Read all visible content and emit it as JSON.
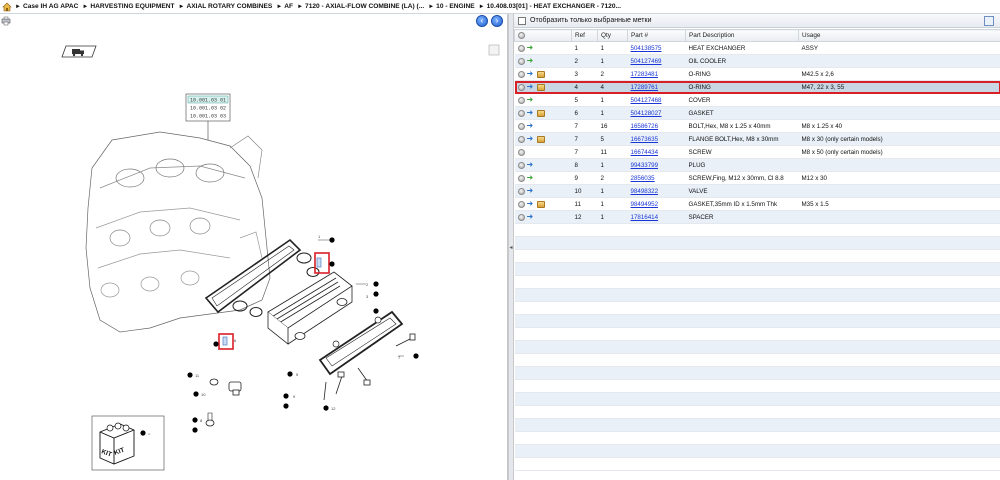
{
  "breadcrumbs": [
    "Case IH AG APAC",
    "HARVESTING EQUIPMENT",
    "AXIAL ROTARY COMBINES",
    "AF",
    "7120 - AXIAL-FLOW COMBINE (LA) (...",
    "10 - ENGINE",
    "10.408.03[01] - HEAT EXCHANGER - 7120..."
  ],
  "right_panel": {
    "filter_label": "Отобразить только выбранные метки",
    "columns": {
      "ref": "Ref",
      "qty": "Qty",
      "part": "Part #",
      "desc": "Part Description",
      "usage": "Usage"
    },
    "rows": [
      {
        "icons": [
          "dot",
          "arrow-green"
        ],
        "ref": "1",
        "qty": "1",
        "part": "504138575",
        "desc": "HEAT EXCHANGER",
        "usage": "ASSY"
      },
      {
        "icons": [
          "dot",
          "arrow-green"
        ],
        "ref": "2",
        "qty": "1",
        "part": "504127469",
        "desc": "OIL COOLER",
        "usage": ""
      },
      {
        "icons": [
          "dot",
          "arrow-blue",
          "box"
        ],
        "ref": "3",
        "qty": "2",
        "part": "17283481",
        "desc": "O-RING",
        "usage": "M42.5 x 2,6"
      },
      {
        "icons": [
          "dot",
          "arrow-blue",
          "box"
        ],
        "ref": "4",
        "qty": "4",
        "part": "17289761",
        "desc": "O-RING",
        "usage": "M47, 22 x 3, 55",
        "selected": true
      },
      {
        "icons": [
          "dot",
          "arrow-green"
        ],
        "ref": "5",
        "qty": "1",
        "part": "504127468",
        "desc": "COVER",
        "usage": ""
      },
      {
        "icons": [
          "dot",
          "arrow-blue",
          "box"
        ],
        "ref": "6",
        "qty": "1",
        "part": "504128027",
        "desc": "GASKET",
        "usage": ""
      },
      {
        "icons": [
          "dot",
          "arrow-blue"
        ],
        "ref": "7",
        "qty": "16",
        "part": "16586726",
        "desc": "BOLT,Hex, M8 x 1.25 x 40mm",
        "usage": "M8 x 1.25 x 40"
      },
      {
        "icons": [
          "dot",
          "arrow-blue",
          "box"
        ],
        "ref": "7",
        "qty": "5",
        "part": "16673635",
        "desc": "FLANGE BOLT,Hex, M8 x 30mm",
        "usage": "M8 x 30 (only certain models)"
      },
      {
        "icons": [
          "dot"
        ],
        "ref": "7",
        "qty": "11",
        "part": "16674434",
        "desc": "SCREW",
        "usage": "M8 x 50 (only certain models)"
      },
      {
        "icons": [
          "dot",
          "arrow-blue"
        ],
        "ref": "8",
        "qty": "1",
        "part": "99433799",
        "desc": "PLUG",
        "usage": ""
      },
      {
        "icons": [
          "dot",
          "arrow-green"
        ],
        "ref": "9",
        "qty": "2",
        "part": "2856035",
        "desc": "SCREW,Fing, M12 x 30mm, Cl 8.8",
        "usage": "M12 x 30"
      },
      {
        "icons": [
          "dot",
          "arrow-blue"
        ],
        "ref": "10",
        "qty": "1",
        "part": "98498322",
        "desc": "VALVE",
        "usage": ""
      },
      {
        "icons": [
          "dot",
          "arrow-blue",
          "box"
        ],
        "ref": "11",
        "qty": "1",
        "part": "98494952",
        "desc": "GASKET,35mm ID x 1.5mm Thk",
        "usage": "M35 x 1.5"
      },
      {
        "icons": [
          "dot",
          "arrow-blue"
        ],
        "ref": "12",
        "qty": "1",
        "part": "17816414",
        "desc": "SPACER",
        "usage": ""
      }
    ]
  },
  "diagram": {
    "codes": [
      "10.001.03 01",
      "10.001.03 02",
      "10.001.03 03"
    ],
    "callouts": [
      "1",
      "2",
      "3",
      "4",
      "5",
      "6",
      "7",
      "8",
      "9",
      "10",
      "11",
      "12"
    ],
    "kit_label": "KIT"
  }
}
